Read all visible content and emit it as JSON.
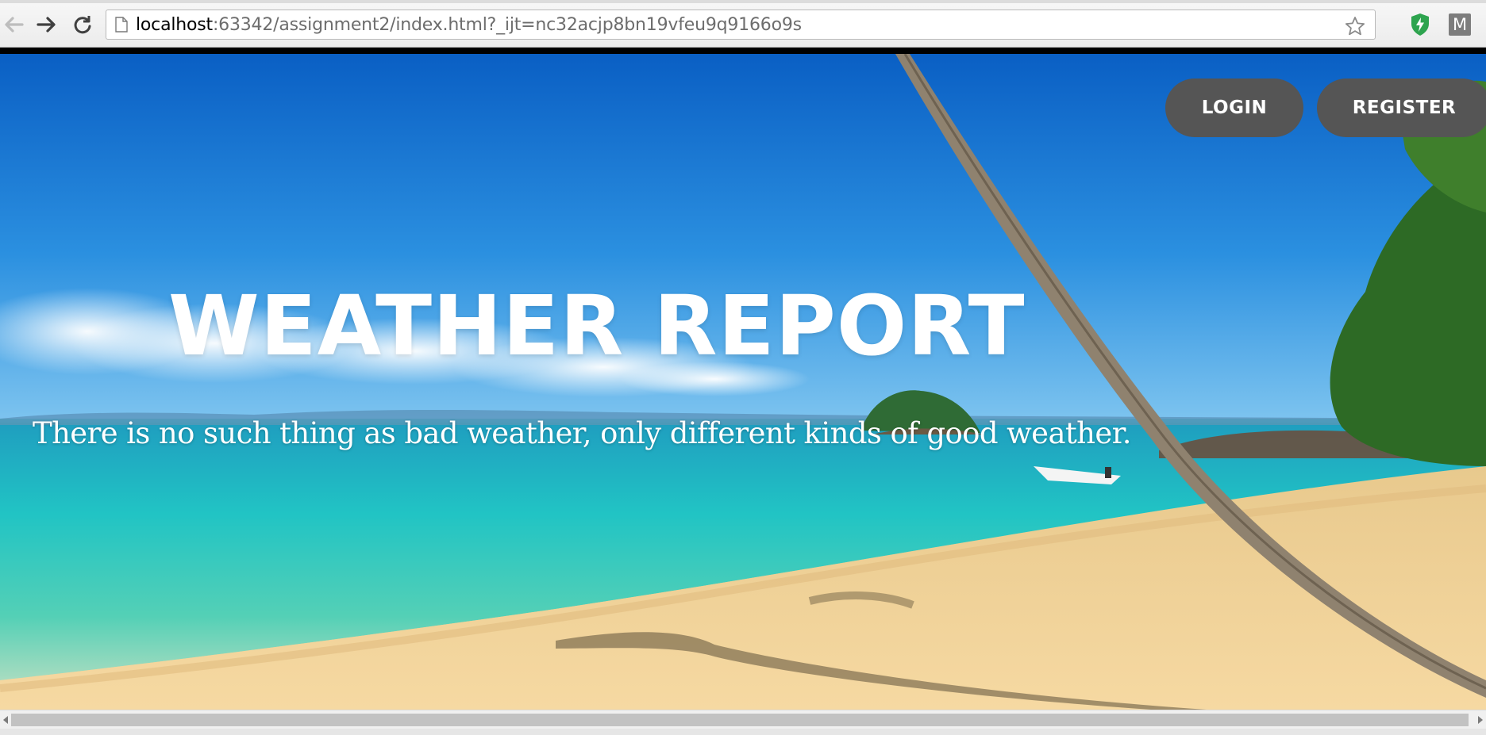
{
  "browser": {
    "url_host": "localhost",
    "url_rest": ":63342/assignment2/index.html?_ijt=nc32acjp8bn19vfeu9q9166o9s",
    "extension_letter": "M"
  },
  "header": {
    "login_label": "LOGIN",
    "register_label": "REGISTER"
  },
  "hero": {
    "title": "WEATHER REPORT",
    "subtitle": "There is no such thing as bad weather, only different kinds of good weather."
  },
  "colors": {
    "button_bg": "#555555",
    "sky": "#1580dc",
    "sea": "#29c1c2",
    "sand": "#f1cf92"
  }
}
